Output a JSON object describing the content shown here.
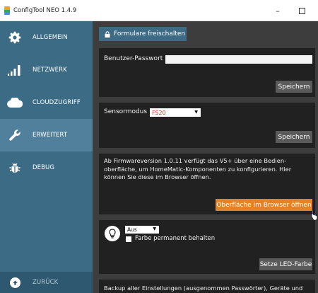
{
  "window": {
    "title": "ConfigTool NEO 1.4.9",
    "minimize_glyph": "–"
  },
  "sidebar": {
    "items": [
      {
        "label": "ALLGEMEIN",
        "icon": "gear-icon"
      },
      {
        "label": "NETZWERK",
        "icon": "signal-bars-icon"
      },
      {
        "label": "CLOUDZUGRIFF",
        "icon": "cloud-icon"
      },
      {
        "label": "ERWEITERT",
        "icon": "wrench-icon",
        "active": true
      },
      {
        "label": "DEBUG",
        "icon": "bug-icon"
      }
    ],
    "back_label": "ZURÜCK"
  },
  "unlock": {
    "button_label": "Formulare freischalten",
    "icon": "lock-icon"
  },
  "password": {
    "label": "Benutzer-Passwort",
    "value": "",
    "save_label": "Speichern"
  },
  "sensor": {
    "label": "Sensormodus",
    "selected": "FS20",
    "save_label": "Speichern"
  },
  "web_ui": {
    "lines": [
      "Ab Firmwareversion 1.0.11 verfügt das V5+ über eine Bedien-",
      "oberfläche, um HomeMatic-Komponenten zu konfigurieren. Hier",
      "können Sie diese im Browser öffnen."
    ],
    "open_label": "Oberfläche im Browser öffnen"
  },
  "led": {
    "selected": "Aus",
    "checkbox_label": "Farbe permanent behalten",
    "checkbox_checked": false,
    "set_label": "Setze LED-Farbe",
    "icon": "lightbulb-icon"
  },
  "backup": {
    "text": "Backup aller Einstellungen (ausgenommen Passwörter), Geräte und"
  },
  "colors": {
    "sidebar": "#3c6b86",
    "sidebar_active": "#50809b",
    "accent_orange": "#e2822a",
    "panel": "#212121"
  }
}
